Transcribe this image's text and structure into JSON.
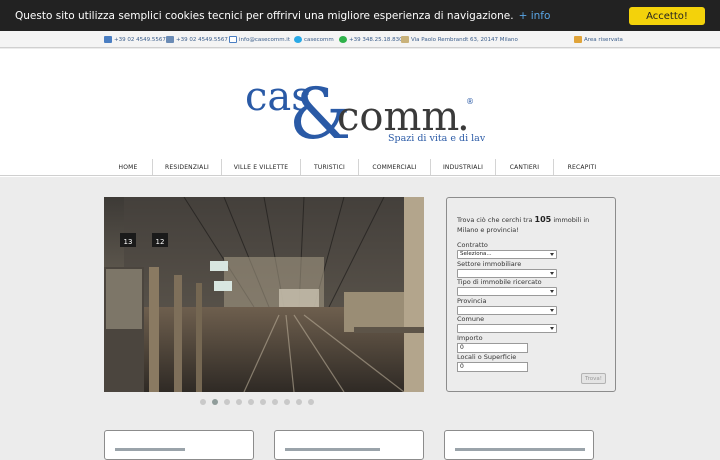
{
  "cookie": {
    "message": "Questo sito utilizza semplici cookies tecnici per offrirvi una migliore esperienza di navigazione.",
    "more_link": "+ info",
    "accept_label": "Accetto!"
  },
  "contacts": {
    "phone": "+39 02 4549.5567",
    "fax": "+39 02 4549.5567",
    "email": "info@casecomm.it",
    "skype": "casecomm",
    "whatsapp": "+39 348.25.18.830",
    "address": "Via Paolo Rembrandt 63, 20147 Milano",
    "reserved_area": "Area riservata"
  },
  "logo": {
    "brand_left": "cas",
    "ampersand": "&",
    "brand_right": "comm",
    "period": ".",
    "registered": "®",
    "tagline": "Spazi di vita e di lavoro."
  },
  "nav": {
    "items": [
      "HOME",
      "RESIDENZIALI",
      "VILLE E VILLETTE",
      "TURISTICI",
      "COMMERCIALI",
      "INDUSTRIALI",
      "CANTIERI",
      "RECAPITI"
    ]
  },
  "slider": {
    "platform_numbers": [
      "13",
      "12"
    ],
    "slide_count": 10,
    "active_index": 1
  },
  "search": {
    "intro_before": "Trova ciò che cerchi tra ",
    "count": "105",
    "intro_after": " immobili in Milano e provincia!",
    "contratto_label": "Contratto",
    "contratto_value": "Seleziona...",
    "settore_label": "Settore immobiliare",
    "tipo_label": "Tipo di immobile ricercato",
    "provincia_label": "Provincia",
    "comune_label": "Comune",
    "importo_label": "Importo",
    "importo_value": "0",
    "locali_label": "Locali o Superficie",
    "locali_value": "0",
    "submit_label": "Trova!"
  },
  "colors": {
    "cookie_bg": "#222222",
    "accept_bg": "#f3d20b",
    "brand_blue": "#2a5aa6",
    "brand_dark": "#3a3a3a"
  }
}
